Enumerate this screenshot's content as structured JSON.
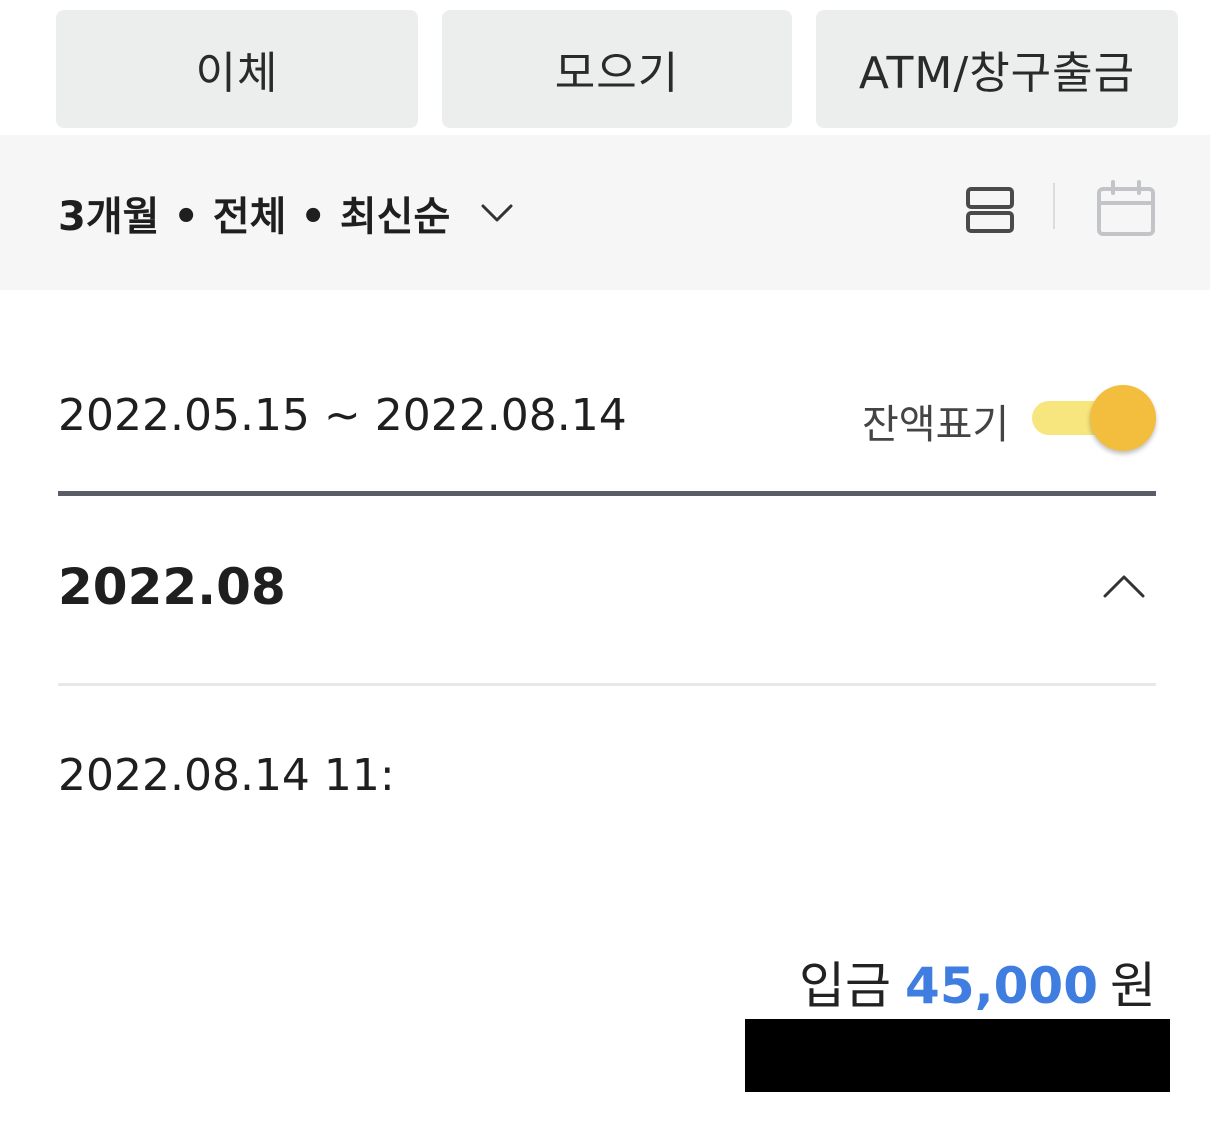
{
  "actions": {
    "transfer_label": "이체",
    "collect_label": "모으기",
    "atm_label": "ATM/창구출금"
  },
  "filter": {
    "summary": "3개월 • 전체 • 최신순",
    "chevron_icon": "chevron-down-icon",
    "list_view_icon": "list-view-icon",
    "calendar_icon": "calendar-icon"
  },
  "period": {
    "range": "2022.05.15 ~ 2022.08.14",
    "balance_toggle_label": "잔액표기",
    "balance_toggle_on": true
  },
  "colors": {
    "toggle_track": "#f7e57e",
    "toggle_knob": "#f3be3e",
    "amount_accent": "#3f7de0",
    "button_bg": "#eceded",
    "filter_bar_bg": "#f6f6f6"
  },
  "month_group": {
    "title": "2022.08",
    "collapse_icon": "chevron-up-icon"
  },
  "transactions": [
    {
      "datetime": "2022.08.14 11:",
      "type": "입금",
      "amount": "45,000",
      "unit": "원"
    }
  ]
}
